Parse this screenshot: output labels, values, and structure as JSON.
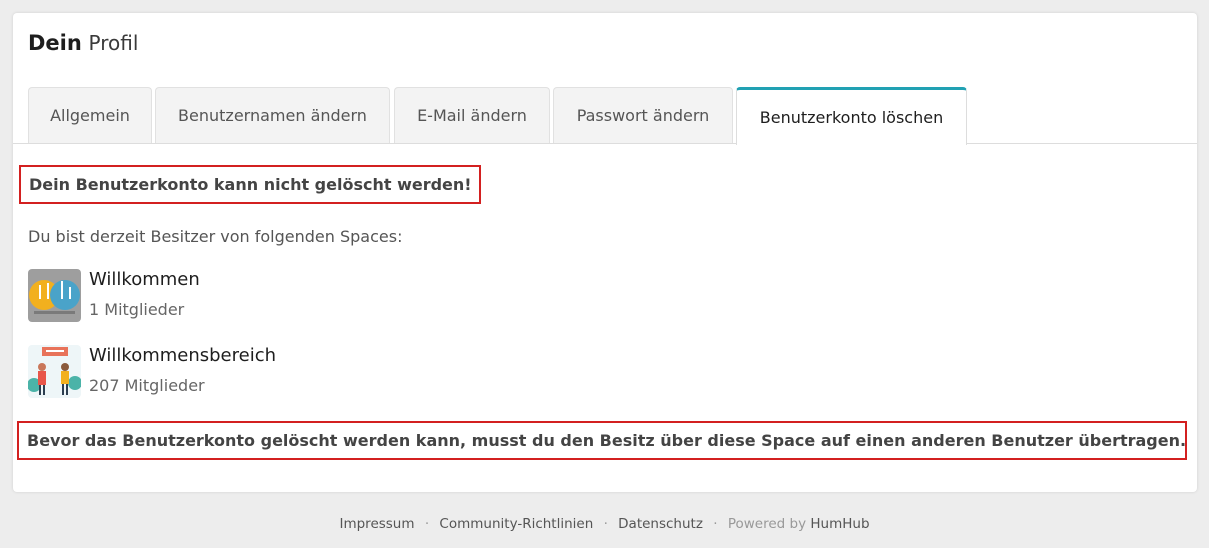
{
  "panel": {
    "title_strong": "Dein",
    "title_light": "Profil"
  },
  "tabs": [
    {
      "label": "Allgemein",
      "active": false
    },
    {
      "label": "Benutzernamen ändern",
      "active": false
    },
    {
      "label": "E-Mail ändern",
      "active": false
    },
    {
      "label": "Passwort ändern",
      "active": false
    },
    {
      "label": "Benutzerkonto löschen",
      "active": true
    }
  ],
  "content": {
    "error_heading": "Dein Benutzerkonto kann nicht gelöscht werden!",
    "intro": "Du bist derzeit Besitzer von folgenden Spaces:",
    "spaces": [
      {
        "name": "Willkommen",
        "members": "1 Mitglieder",
        "icon": "welcome-space-icon"
      },
      {
        "name": "Willkommensbereich",
        "members": "207 Mitglieder",
        "icon": "welcome-area-space-icon"
      }
    ],
    "transfer_notice": "Bevor das Benutzerkonto gelöscht werden kann, musst du den Besitz über diese Space auf einen anderen Benutzer übertragen."
  },
  "footer": {
    "links": [
      "Impressum",
      "Community-Richtlinien",
      "Datenschutz"
    ],
    "powered_prefix": "Powered by",
    "powered_brand": "HumHub",
    "separator": "·"
  },
  "colors": {
    "accent": "#21a1b3",
    "highlight_border": "#d32020",
    "background": "#ededed"
  }
}
